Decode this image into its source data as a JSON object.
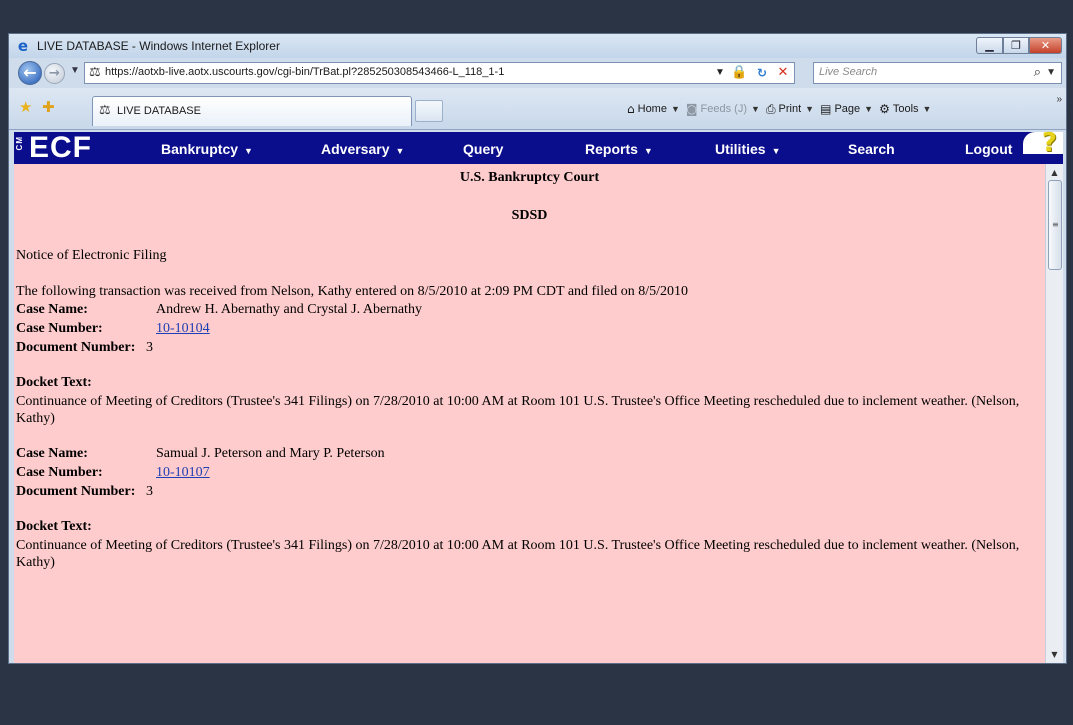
{
  "browser": {
    "title": "LIVE DATABASE - Windows Internet Explorer",
    "url": "https://aotxb-live.aotx.uscourts.gov/cgi-bin/TrBat.pl?285250308543466-L_118_1-1",
    "search_placeholder": "Live Search",
    "tab_label": "LIVE DATABASE",
    "commands": {
      "home": "Home",
      "feeds": "Feeds (J)",
      "print": "Print",
      "page": "Page",
      "tools": "Tools"
    }
  },
  "ecf": {
    "logo_cm": "CM",
    "logo_text": "ECF",
    "menu": {
      "bankruptcy": "Bankruptcy",
      "adversary": "Adversary",
      "query": "Query",
      "reports": "Reports",
      "utilities": "Utilities",
      "search": "Search",
      "logout": "Logout"
    },
    "help_glyph": "?"
  },
  "notice": {
    "court": "U.S. Bankruptcy Court",
    "district": "SDSD",
    "heading": "Notice of Electronic Filing",
    "intro": "The following transaction was received from Nelson, Kathy entered on 8/5/2010 at 2:09 PM CDT and filed on 8/5/2010",
    "labels": {
      "case_name": "Case Name:",
      "case_number": "Case Number:",
      "document_number": "Document Number:",
      "docket_text": "Docket Text:"
    },
    "cases": [
      {
        "name": "Andrew H. Abernathy and Crystal J. Abernathy",
        "number": "10-10104",
        "document": "3",
        "docket_text": "Continuance of Meeting of Creditors (Trustee's 341 Filings) on 7/28/2010 at 10:00 AM at Room 101 U.S. Trustee's Office Meeting rescheduled due to inclement weather. (Nelson, Kathy)"
      },
      {
        "name": "Samual J. Peterson and Mary P. Peterson",
        "number": "10-10107",
        "document": "3",
        "docket_text": "Continuance of Meeting of Creditors (Trustee's 341 Filings) on 7/28/2010 at 10:00 AM at Room 101 U.S. Trustee's Office Meeting rescheduled due to inclement weather. (Nelson, Kathy)"
      }
    ]
  }
}
